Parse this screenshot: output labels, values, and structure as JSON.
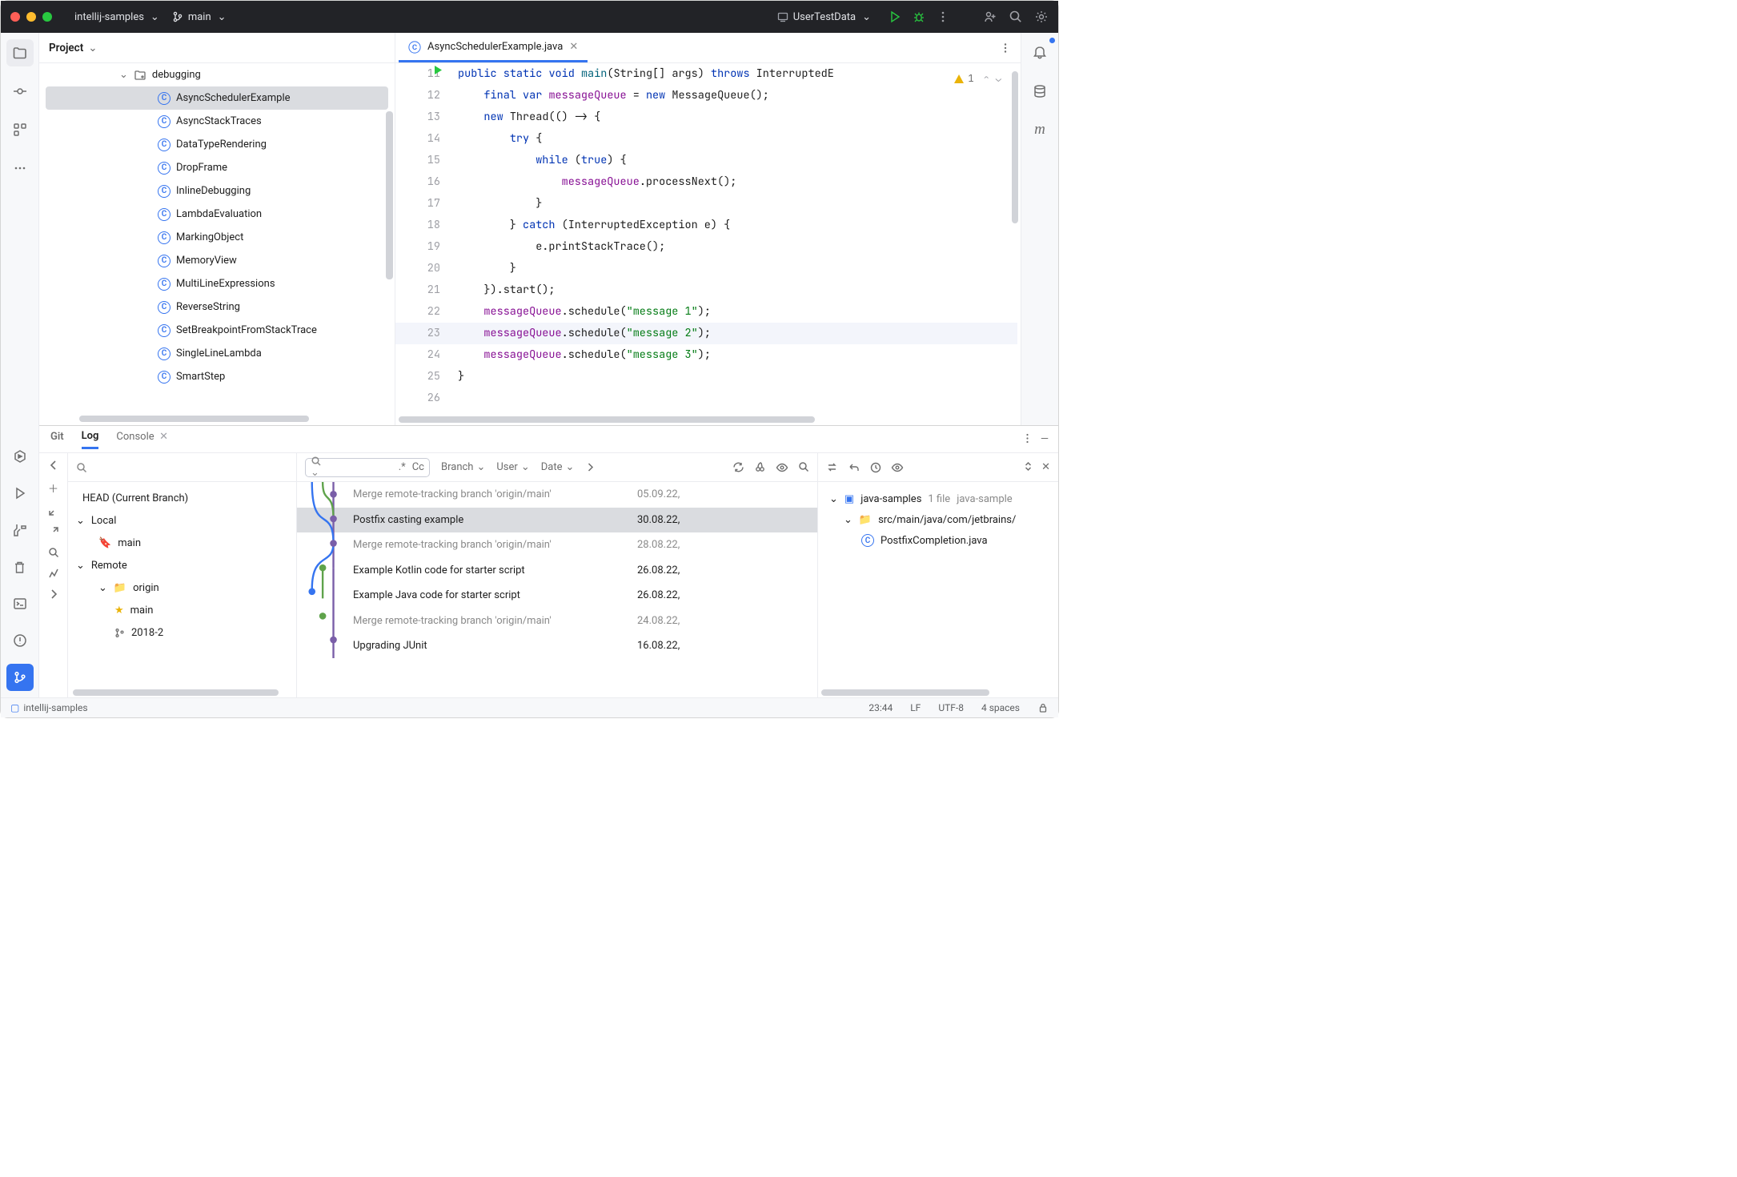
{
  "titlebar": {
    "project": "intellij-samples",
    "branch": "main",
    "run_config": "UserTestData"
  },
  "project_panel": {
    "title": "Project",
    "folder": "debugging",
    "files": [
      "AsyncSchedulerExample",
      "AsyncStackTraces",
      "DataTypeRendering",
      "DropFrame",
      "InlineDebugging",
      "LambdaEvaluation",
      "MarkingObject",
      "MemoryView",
      "MultiLineExpressions",
      "ReverseString",
      "SetBreakpointFromStackTrace",
      "SingleLineLambda",
      "SmartStep"
    ],
    "selected": 0
  },
  "editor": {
    "tab_name": "AsyncSchedulerExample.java",
    "warn_count": "1",
    "line_start": 11,
    "line_end": 26,
    "current_line": 23
  },
  "bottom": {
    "tabs": [
      "Git",
      "Log",
      "Console"
    ],
    "active": 1,
    "branches": {
      "head": "HEAD (Current Branch)",
      "local_label": "Local",
      "local": [
        "main"
      ],
      "remote_label": "Remote",
      "origin": "origin",
      "remote_branches": [
        "main",
        "2018-2"
      ]
    },
    "filters": {
      "branch": "Branch",
      "user": "User",
      "date": "Date",
      "regex": ".*",
      "cc": "Cc"
    },
    "commits": [
      {
        "msg": "Merge remote-tracking branch 'origin/main'",
        "date": "05.09.22,",
        "muted": true
      },
      {
        "msg": "Postfix casting example",
        "date": "30.08.22,",
        "sel": true
      },
      {
        "msg": "Merge remote-tracking branch 'origin/main'",
        "date": "28.08.22,",
        "muted": true
      },
      {
        "msg": "Example Kotlin code for starter script",
        "date": "26.08.22,"
      },
      {
        "msg": "Example Java code for starter script",
        "date": "26.08.22,"
      },
      {
        "msg": "Merge remote-tracking branch 'origin/main'",
        "date": "24.08.22,",
        "muted": true
      },
      {
        "msg": "Upgrading JUnit",
        "date": "16.08.22,"
      }
    ],
    "details": {
      "repo": "java-samples",
      "file_count": "1 file",
      "extra": "java-sample",
      "path": "src/main/java/com/jetbrains/",
      "changed_file": "PostfixCompletion.java"
    }
  },
  "statusbar": {
    "module": "intellij-samples",
    "time": "23:44",
    "le": "LF",
    "enc": "UTF-8",
    "indent": "4 spaces"
  }
}
